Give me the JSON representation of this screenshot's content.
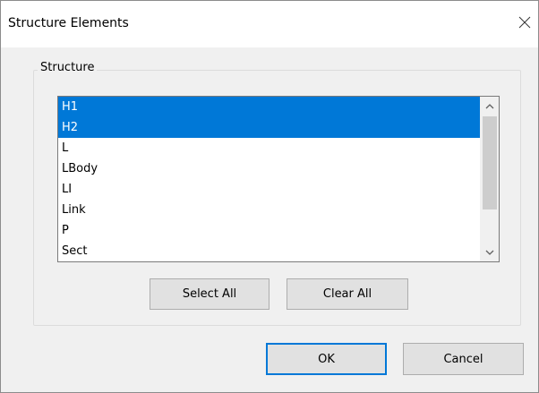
{
  "window": {
    "title": "Structure Elements",
    "close_icon": "close-icon"
  },
  "group": {
    "label": "Structure"
  },
  "list": {
    "items": [
      {
        "label": "H1",
        "selected": true
      },
      {
        "label": "H2",
        "selected": true
      },
      {
        "label": "L",
        "selected": false
      },
      {
        "label": "LBody",
        "selected": false
      },
      {
        "label": "LI",
        "selected": false
      },
      {
        "label": "Link",
        "selected": false
      },
      {
        "label": "P",
        "selected": false
      },
      {
        "label": "Sect",
        "selected": false
      }
    ],
    "selection_color": "#0078d7"
  },
  "buttons": {
    "select_all": "Select All",
    "clear_all": "Clear All",
    "ok": "OK",
    "cancel": "Cancel"
  }
}
